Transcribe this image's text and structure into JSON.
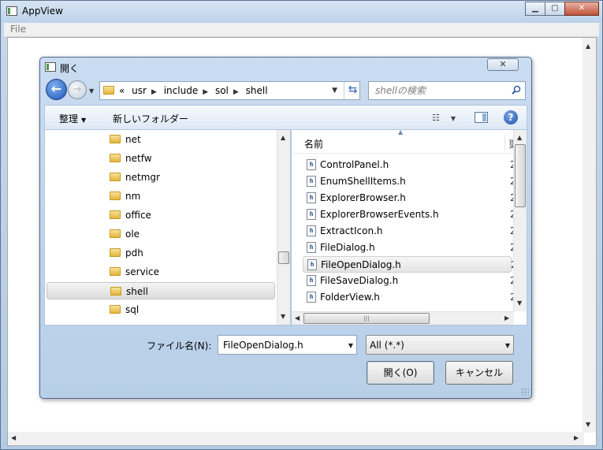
{
  "app": {
    "title": "AppView",
    "menu": [
      "File"
    ]
  },
  "dialog": {
    "title": "開く",
    "close_label": "✕",
    "breadcrumb": {
      "overflow": "«",
      "parts": [
        "usr",
        "include",
        "sol",
        "shell"
      ]
    },
    "search": {
      "placeholder": "shellの検索"
    },
    "commands": {
      "organize": "整理",
      "new_folder": "新しいフォルダー"
    },
    "nav_tree": {
      "items": [
        "net",
        "netfw",
        "netmgr",
        "nm",
        "office",
        "ole",
        "pdh",
        "service",
        "shell",
        "sql"
      ],
      "selected": "shell"
    },
    "file_list": {
      "column_name": "名前",
      "column_next": "更",
      "files": [
        "ControlPanel.h",
        "EnumShellItems.h",
        "ExplorerBrowser.h",
        "ExplorerBrowserEvents.h",
        "ExtractIcon.h",
        "FileDialog.h",
        "FileOpenDialog.h",
        "FileSaveDialog.h",
        "FolderView.h"
      ],
      "date_prefix": "2",
      "selected": "FileOpenDialog.h"
    },
    "filename": {
      "label": "ファイル名(N):",
      "value": "FileOpenDialog.h"
    },
    "filter": {
      "value": "All (*.*)"
    },
    "buttons": {
      "open": "開く(O)",
      "cancel": "キャンセル"
    }
  },
  "colors": {
    "accent": "#1d54b8",
    "dialog_frame": "#c9dcf1"
  }
}
